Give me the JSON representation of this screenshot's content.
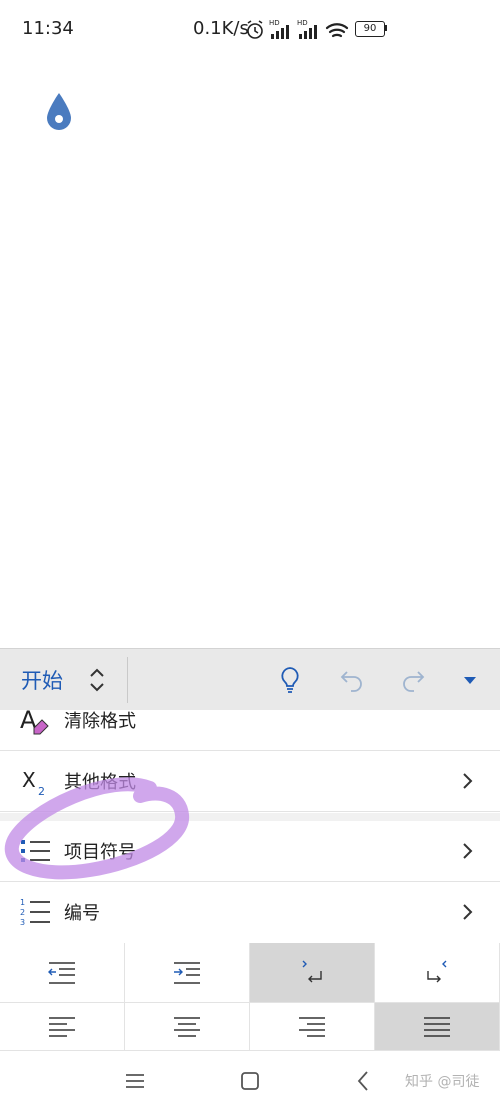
{
  "status_bar": {
    "time": "11:34",
    "network_speed": "0.1K/s",
    "battery": "90"
  },
  "ribbon": {
    "tab_title": "开始"
  },
  "menu": {
    "items": [
      {
        "label": "清除格式",
        "icon": "clear-format-icon",
        "has_arrow": false
      },
      {
        "label": "其他格式",
        "icon": "subscript-icon",
        "has_arrow": true
      },
      {
        "label": "项目符号",
        "icon": "bullet-list-icon",
        "has_arrow": true
      },
      {
        "label": "编号",
        "icon": "numbered-list-icon",
        "has_arrow": true
      }
    ]
  },
  "paragraph_tools": {
    "row1": [
      {
        "icon": "decrease-indent-icon",
        "selected": false
      },
      {
        "icon": "increase-indent-icon",
        "selected": false
      },
      {
        "icon": "left-to-right-icon",
        "selected": true
      },
      {
        "icon": "right-to-left-icon",
        "selected": false
      }
    ],
    "row2": [
      {
        "icon": "align-left-icon",
        "selected": false
      },
      {
        "icon": "align-center-icon",
        "selected": false
      },
      {
        "icon": "align-right-icon",
        "selected": false
      },
      {
        "icon": "justify-icon",
        "selected": true
      }
    ]
  },
  "watermark": "知乎 @司徒",
  "colors": {
    "accent": "#1f5bb5",
    "annotation": "#c08ae6",
    "selected_bg": "#d6d6d6",
    "ribbon_bg": "#e9e9e9"
  }
}
